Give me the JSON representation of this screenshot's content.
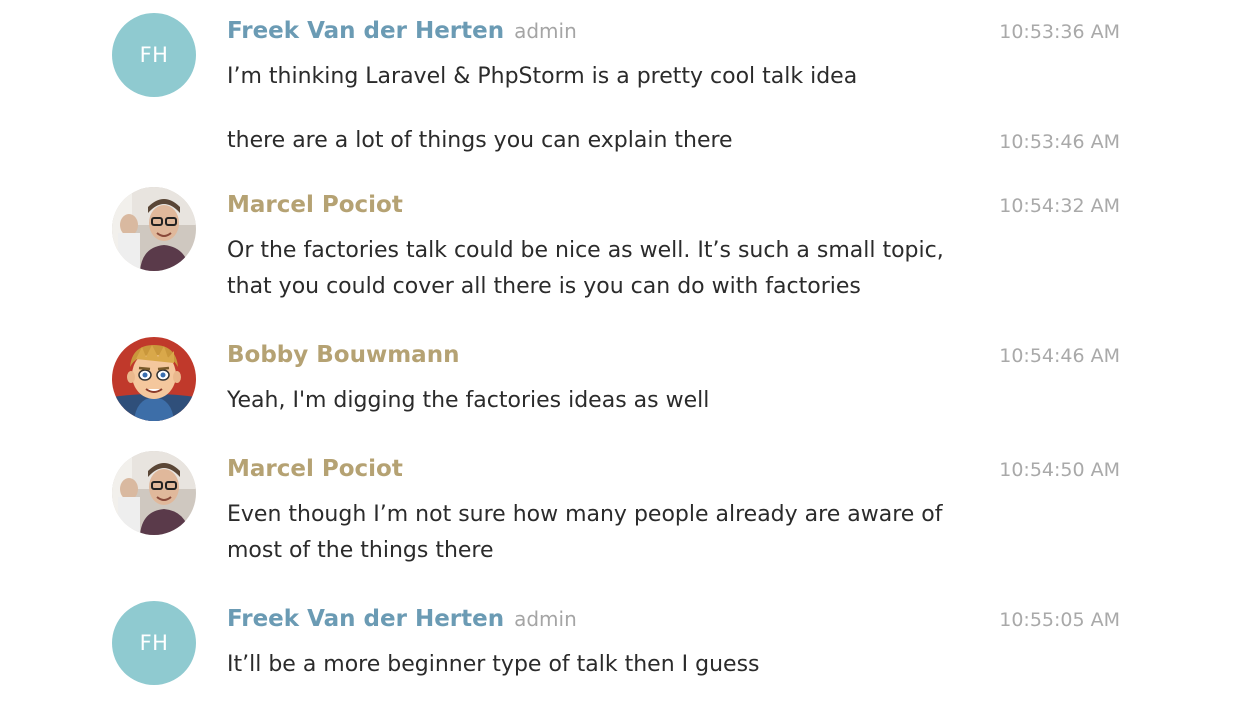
{
  "messages": [
    {
      "author": "Freek Van der Herten",
      "role": "admin",
      "avatar_initials": "FH",
      "avatar_color": "#8fcad0",
      "lines": [
        {
          "text": "I’m thinking Laravel & PhpStorm is a pretty cool talk idea",
          "time": "10:53:36 AM"
        },
        {
          "text": "there are a lot of things you can explain there",
          "time": "10:53:46 AM"
        }
      ]
    },
    {
      "author": "Marcel Pociot",
      "avatar_icon": "photo-avatar-icon",
      "text_lines": [
        "Or the factories talk could be nice as well. It’s such a small topic,",
        "that you could cover all there is you can do with factories"
      ],
      "time": "10:54:32 AM"
    },
    {
      "author": "Bobby Bouwmann",
      "avatar_icon": "cartoon-avatar-icon",
      "text_lines": [
        "Yeah, I'm digging the factories ideas as well"
      ],
      "time": "10:54:46 AM"
    },
    {
      "author": "Marcel Pociot",
      "avatar_icon": "photo-avatar-icon",
      "text_lines": [
        "Even though I’m not sure how many people already are aware of",
        "most of the things there"
      ],
      "time": "10:54:50 AM"
    },
    {
      "author": "Freek Van der Herten",
      "role": "admin",
      "avatar_initials": "FH",
      "avatar_color": "#8fcad0",
      "text_lines": [
        "It’ll be a more beginner type of talk then I guess"
      ],
      "time": "10:55:05 AM"
    }
  ],
  "colors": {
    "admin_name": "#6b9bb4",
    "user_name": "#b5a273",
    "role": "#a5a5a5",
    "time": "#a9a9a9",
    "text": "#2b2b2b"
  }
}
